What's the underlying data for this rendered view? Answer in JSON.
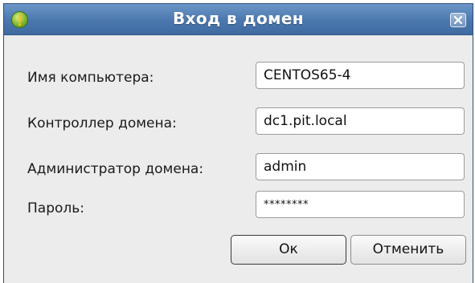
{
  "window": {
    "title": "Вход в домен",
    "app_icon": "info-icon",
    "close_icon": "close-icon"
  },
  "form": {
    "computer_name": {
      "label": "Имя компьютера:",
      "value": "CENTOS65-4"
    },
    "domain_controller": {
      "label": "Контроллер домена:",
      "value": "dc1.pit.local"
    },
    "domain_admin": {
      "label": "Администратор домена:",
      "value": "admin"
    },
    "password": {
      "label": "Пароль:",
      "value": "********"
    }
  },
  "buttons": {
    "ok_label": "Ок",
    "cancel_label": "Отменить"
  },
  "colors": {
    "titlebar": "#4a77ad",
    "dialog_bg": "#ececec"
  }
}
